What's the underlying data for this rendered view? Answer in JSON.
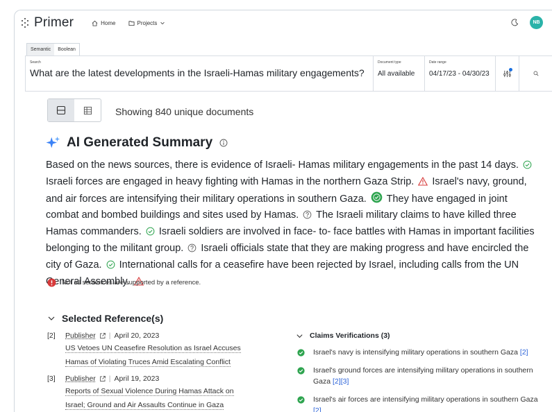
{
  "app": {
    "logo_text": "Primer",
    "avatar_initials": "NB"
  },
  "nav": {
    "home": "Home",
    "projects": "Projects"
  },
  "mode_tabs": [
    "Semantic",
    "Boolean"
  ],
  "search": {
    "label": "Search",
    "query": "What are the latest developments in the Israeli-Hamas military engagements?",
    "doc_type_label": "Document type",
    "doc_type_value": "All available",
    "date_label": "Date range",
    "date_value": "04/17/23 - 04/30/23"
  },
  "results": {
    "showing": "Showing 840 unique documents"
  },
  "summary": {
    "title": "AI Generated Summary",
    "segments": [
      {
        "text": "Based on the news sources, there is evidence of Israeli- Hamas military engagements in the past 14 days.",
        "marker": "check"
      },
      {
        "text": "Israeli forces are engaged in heavy fighting with Hamas in the northern Gaza Strip.",
        "marker": "warning"
      },
      {
        "text": "Israel's navy, ground, and air forces are intensifying their military operations in southern Gaza.",
        "marker": "check-filled"
      },
      {
        "text": "They have engaged in joint combat and bombed buildings and sites used by Hamas.",
        "marker": "question"
      },
      {
        "text": "The Israeli military claims to have killed three Hamas commanders.",
        "marker": "check"
      },
      {
        "text": "Israeli soldiers are involved in face- to- face battles with Hamas in important facilities belonging to the militant group.",
        "marker": "question"
      },
      {
        "text": "Israeli officials state that they are making progress and have encircled the city of Gaza.",
        "marker": "check"
      },
      {
        "text": "International calls for a ceasefire have been rejected by Israel, including calls from the UN General Assembly.",
        "marker": "warning"
      }
    ],
    "warning": "Not all sentences are supported by a reference."
  },
  "references": {
    "title": "Selected Reference(s)",
    "items": [
      {
        "num": "[2]",
        "publisher": "Publisher",
        "date": "April 20, 2023",
        "title_lines": [
          "US Vetoes UN Ceasefire Resolution as Israel Accuses",
          "Hamas of Violating Truces Amid Escalating Conflict"
        ]
      },
      {
        "num": "[3]",
        "publisher": "Publisher",
        "date": "April 19, 2023",
        "title_lines": [
          "Reports of Sexual Violence During Hamas Attack on",
          "Israel; Ground and Air Assaults Continue in Gaza"
        ]
      }
    ]
  },
  "claims": {
    "title": "Claims Verifications (3)",
    "items": [
      {
        "text": "Israel's navy is intensifying military operations in southern Gaza",
        "refs": "[2]"
      },
      {
        "text": "Israel's ground forces are intensifying military operations in southern Gaza",
        "refs": "[2][3]"
      },
      {
        "text": "Israel's air forces are intensifying military operations in southern Gaza",
        "refs": "[2]"
      }
    ]
  },
  "colors": {
    "accent": "#2b63d9",
    "check": "#2ea44f",
    "warning": "#d73a3a",
    "avatar": "#2bb3a9",
    "sparkle": "#3b82f6"
  }
}
